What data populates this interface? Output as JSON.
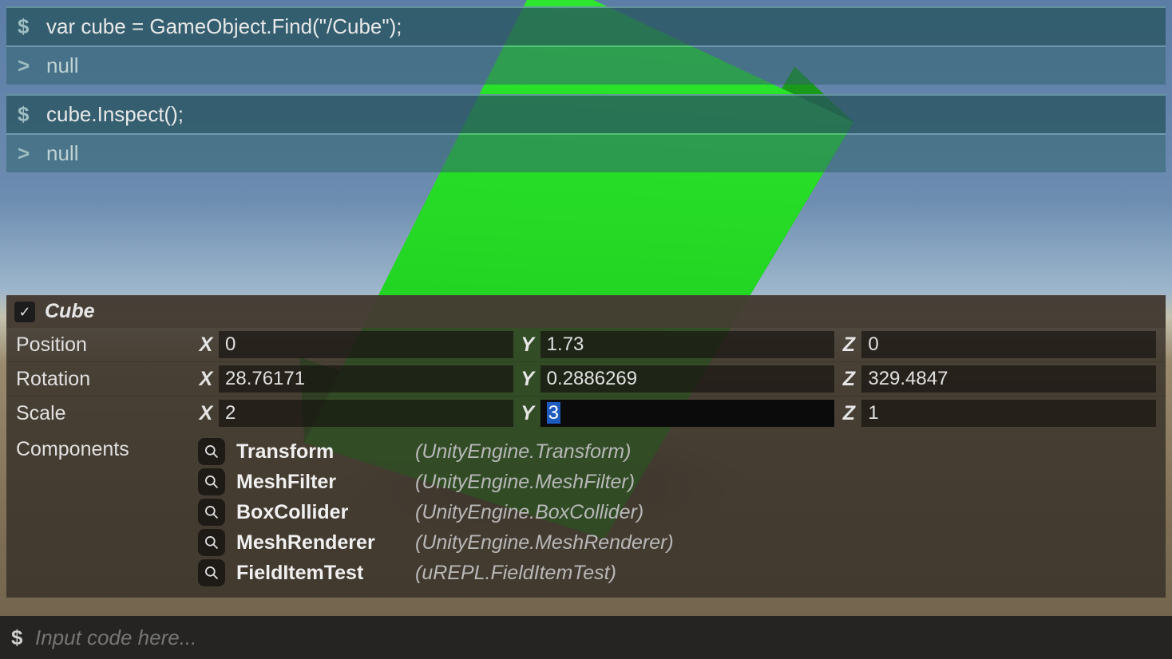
{
  "repl": {
    "blocks": [
      {
        "prompt": "$",
        "command": "var cube = GameObject.Find(\"/Cube\");",
        "out_prompt": ">",
        "output": "null"
      },
      {
        "prompt": "$",
        "command": "cube.Inspect();",
        "out_prompt": ">",
        "output": "null"
      }
    ]
  },
  "inspector": {
    "checked": true,
    "object_name": "Cube",
    "rows": {
      "position": {
        "label": "Position",
        "x": "0",
        "y": "1.73",
        "z": "0"
      },
      "rotation": {
        "label": "Rotation",
        "x": "28.76171",
        "y": "0.2886269",
        "z": "329.4847"
      },
      "scale": {
        "label": "Scale",
        "x": "2",
        "y": "3",
        "z": "1",
        "y_selected": true
      }
    },
    "components_label": "Components",
    "components": [
      {
        "name": "Transform",
        "type": "(UnityEngine.Transform)"
      },
      {
        "name": "MeshFilter",
        "type": "(UnityEngine.MeshFilter)"
      },
      {
        "name": "BoxCollider",
        "type": "(UnityEngine.BoxCollider)"
      },
      {
        "name": "MeshRenderer",
        "type": "(UnityEngine.MeshRenderer)"
      },
      {
        "name": "FieldItemTest",
        "type": "(uREPL.FieldItemTest)"
      }
    ],
    "axis": {
      "x": "X",
      "y": "Y",
      "z": "Z"
    }
  },
  "inputbar": {
    "prompt": "$",
    "placeholder": "Input code here..."
  }
}
